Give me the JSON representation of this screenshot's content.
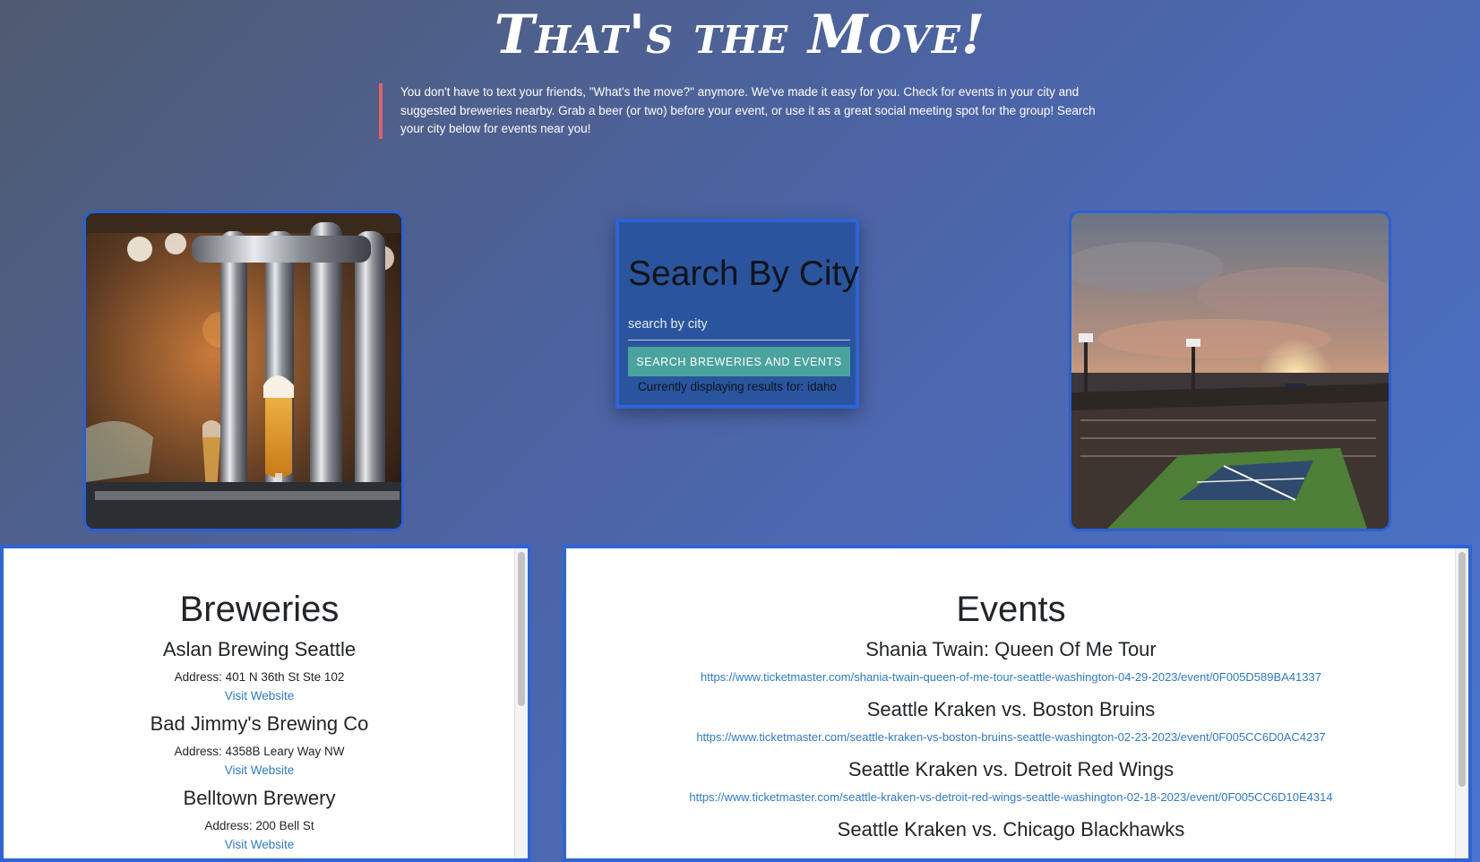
{
  "header": {
    "title": "That's the Move!",
    "intro": "You don't have to text your friends, \"What's the move?\" anymore. We've made it easy for you. Check for events in your city and suggested breweries nearby. Grab a beer (or two) before your event, or use it as a great social meeting spot for the group! Search your city below for events near you!"
  },
  "search": {
    "heading": "Search By City",
    "placeholder": "search by city",
    "value": "",
    "button_label": "SEARCH BREWERIES AND EVENTS",
    "status": "Currently displaying results for: idaho"
  },
  "breweries": {
    "heading": "Breweries",
    "items": [
      {
        "name": "Aslan Brewing Seattle",
        "address": "Address: 401 N 36th St Ste 102",
        "link_label": "Visit Website"
      },
      {
        "name": "Bad Jimmy's Brewing Co",
        "address": "Address: 4358B Leary Way NW",
        "link_label": "Visit Website"
      },
      {
        "name": "Belltown Brewery",
        "address": "Address: 200 Bell St",
        "link_label": "Visit Website"
      }
    ]
  },
  "events": {
    "heading": "Events",
    "items": [
      {
        "name": "Shania Twain: Queen Of Me Tour",
        "url": "https://www.ticketmaster.com/shania-twain-queen-of-me-tour-seattle-washington-04-29-2023/event/0F005D589BA41337"
      },
      {
        "name": "Seattle Kraken vs. Boston Bruins",
        "url": "https://www.ticketmaster.com/seattle-kraken-vs-boston-bruins-seattle-washington-02-23-2023/event/0F005CC6D0AC4237"
      },
      {
        "name": "Seattle Kraken vs. Detroit Red Wings",
        "url": "https://www.ticketmaster.com/seattle-kraken-vs-detroit-red-wings-seattle-washington-02-18-2023/event/0F005CC6D10E4314"
      },
      {
        "name": "Seattle Kraken vs. Chicago Blackhawks",
        "url": ""
      }
    ]
  },
  "colors": {
    "accent_border": "#2e64d6",
    "button": "#4aa39e",
    "link": "#2f7ac7",
    "quote_bar": "#e2606d"
  }
}
